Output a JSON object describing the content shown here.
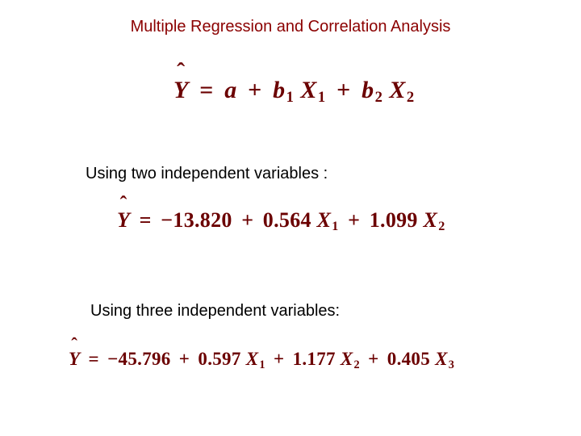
{
  "title": "Multiple Regression and Correlation Analysis",
  "caption_two": "Using two independent variables :",
  "caption_three": "Using three independent variables:",
  "eq_general": {
    "intercept": "a",
    "terms": [
      {
        "coef": "b",
        "coef_sub": "1",
        "var": "X",
        "var_sub": "1"
      },
      {
        "coef": "b",
        "coef_sub": "2",
        "var": "X",
        "var_sub": "2"
      }
    ]
  },
  "eq_two": {
    "intercept": "−13.820",
    "terms": [
      {
        "coef": "0.564",
        "var": "X",
        "var_sub": "1"
      },
      {
        "coef": "1.099",
        "var": "X",
        "var_sub": "2"
      }
    ]
  },
  "eq_three": {
    "intercept": "−45.796",
    "terms": [
      {
        "coef": "0.597",
        "var": "X",
        "var_sub": "1"
      },
      {
        "coef": "1.177",
        "var": "X",
        "var_sub": "2"
      },
      {
        "coef": "0.405",
        "var": "X",
        "var_sub": "3"
      }
    ]
  }
}
